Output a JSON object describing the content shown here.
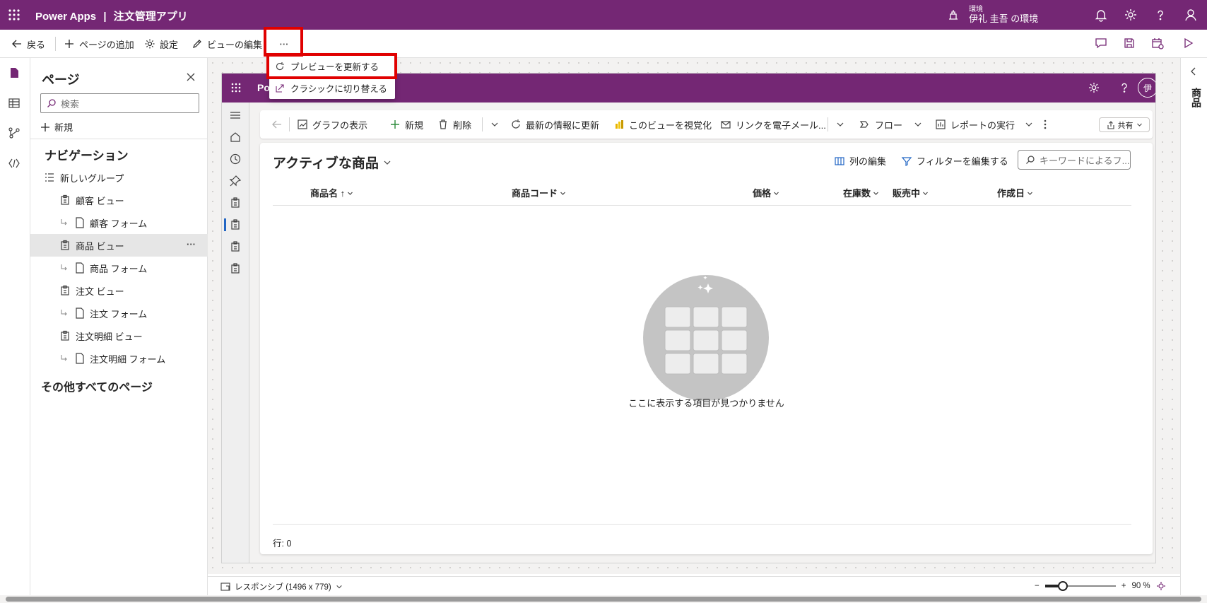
{
  "header": {
    "app_brand": "Power Apps",
    "separator": "|",
    "app_title": "注文管理アプリ",
    "env_label": "環境",
    "env_name": "伊礼 圭吾 の環境",
    "bg_color": "#742774"
  },
  "toolbar": {
    "back": "戻る",
    "add_page": "ページの追加",
    "settings": "設定",
    "edit_view": "ビューの編集",
    "more": "···"
  },
  "dropdown": {
    "refresh_preview": "プレビューを更新する",
    "switch_classic": "クラシックに切り替える"
  },
  "pages_panel": {
    "title": "ページ",
    "search_placeholder": "検索",
    "new": "新規",
    "nav_heading": "ナビゲーション",
    "group": "新しいグループ",
    "items": [
      {
        "label": "顧客 ビュー",
        "kind": "view"
      },
      {
        "label": "顧客 フォーム",
        "kind": "form"
      },
      {
        "label": "商品 ビュー",
        "kind": "view",
        "selected": true
      },
      {
        "label": "商品 フォーム",
        "kind": "form"
      },
      {
        "label": "注文 ビュー",
        "kind": "view"
      },
      {
        "label": "注文 フォーム",
        "kind": "form"
      },
      {
        "label": "注文明細 ビュー",
        "kind": "view"
      },
      {
        "label": "注文明細 フォーム",
        "kind": "form"
      }
    ],
    "item_more": "···",
    "other_heading": "その他すべてのページ"
  },
  "preview": {
    "app_name_visible": "Pow",
    "avatar": "伊",
    "commands": {
      "show_chart": "グラフの表示",
      "new": "新規",
      "delete": "削除",
      "refresh": "最新の情報に更新",
      "visualize": "このビューを視覚化",
      "email_link": "リンクを電子メール...",
      "flow": "フロー",
      "run_report": "レポートの実行",
      "share": "共有"
    },
    "view_title": "アクティブな商品",
    "edit_columns": "列の編集",
    "edit_filters": "フィルターを編集する",
    "keyword_search": "キーワードによるフ...",
    "columns": [
      "商品名 ↑",
      "商品コード",
      "価格",
      "在庫数",
      "販売中",
      "作成日"
    ],
    "empty_message": "ここに表示する項目が見つかりません",
    "row_count": "行: 0"
  },
  "statusbar": {
    "layout": "レスポンシブ (1496 x 779)",
    "zoom_minus": "−",
    "zoom_plus": "+",
    "zoom_value": "90 %",
    "zoom_level": 0.9
  },
  "right_panel": {
    "label": "商品"
  },
  "colors": {
    "accent": "#742774",
    "highlight": "#e00000",
    "selected_row": "#e6e6e6"
  }
}
